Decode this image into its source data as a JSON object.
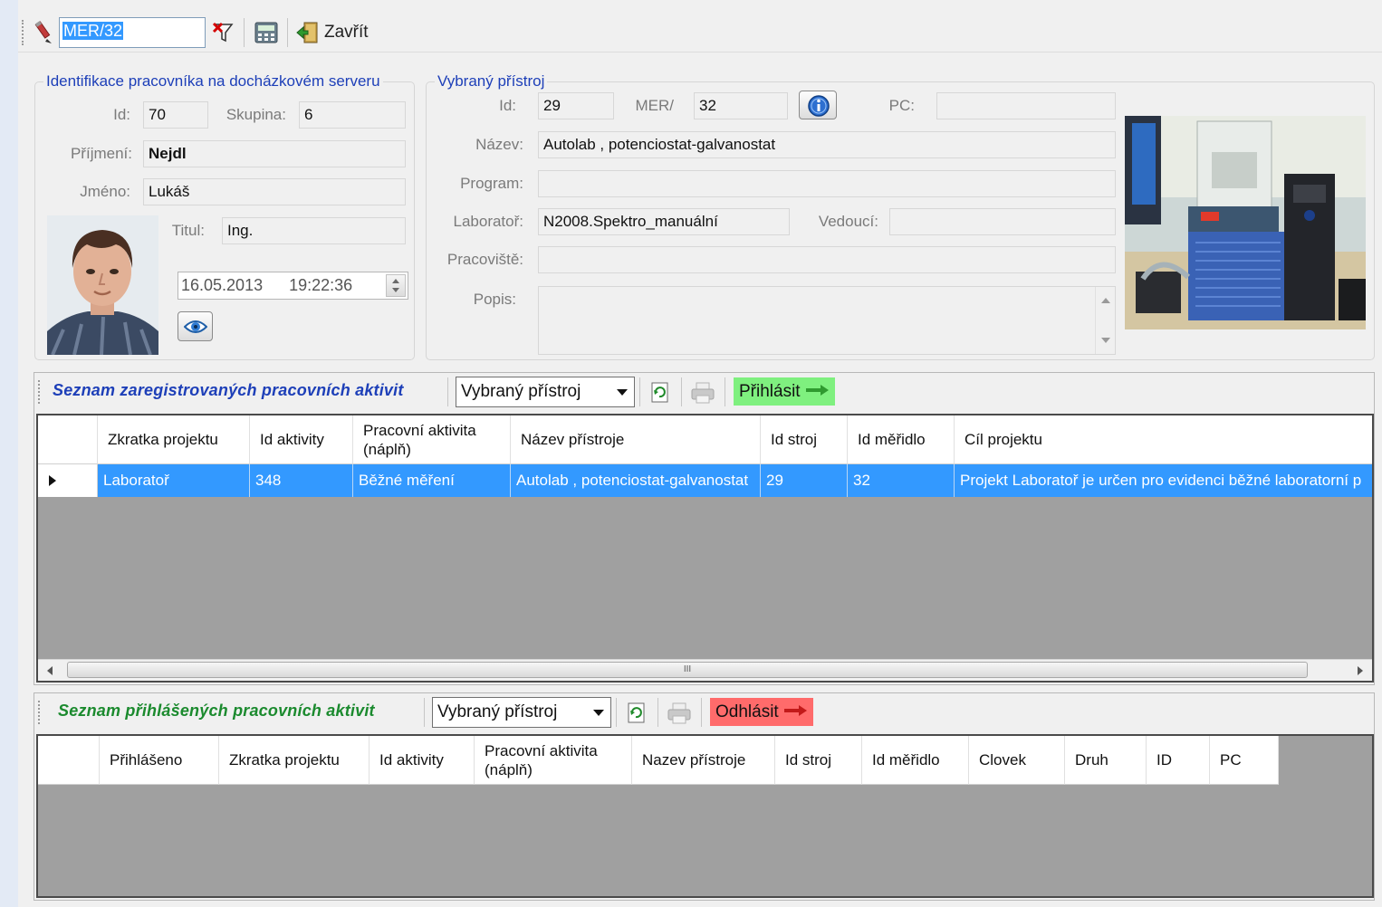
{
  "toolbar": {
    "search_value": "MER/32",
    "close_label": "Zavřít"
  },
  "worker": {
    "group_title": "Identifikace pracovníka na docházkovém serveru",
    "id_label": "Id:",
    "id_value": "70",
    "group_label": "Skupina:",
    "group_value": "6",
    "surname_label": "Příjmení:",
    "surname_value": "Nejdl",
    "name_label": "Jméno:",
    "name_value": "Lukáš",
    "title_label": "Titul:",
    "title_value": "Ing.",
    "date_value": "16.05.2013",
    "time_value": "19:22:36"
  },
  "device": {
    "group_title": "Vybraný přístroj",
    "id_label": "Id:",
    "id_value": "29",
    "mer_label": "MER/",
    "mer_value": "32",
    "pc_label": "PC:",
    "pc_value": "",
    "name_label": "Název:",
    "name_value": "Autolab , potenciostat-galvanostat",
    "program_label": "Program:",
    "program_value": "",
    "lab_label": "Laboratoř:",
    "lab_value": "N2008.Spektro_manuální",
    "head_label": "Vedoucí:",
    "head_value": "",
    "workplace_label": "Pracoviště:",
    "workplace_value": "",
    "desc_label": "Popis:",
    "desc_value": ""
  },
  "registered": {
    "title": "Seznam zaregistrovaných pracovních aktivit",
    "filter_value": "Vybraný přístroj",
    "action_label": "Přihlásit",
    "columns": [
      "Zkratka projektu",
      "Id aktivity",
      "Pracovní aktivita (náplň)",
      "Název přístroje",
      "Id stroj",
      "Id měřidlo",
      "Cíl projektu"
    ],
    "row": {
      "project": "Laboratoř",
      "activity_id": "348",
      "activity": "Běžné měření",
      "device_name": "Autolab , potenciostat-galvanostat",
      "machine_id": "29",
      "meter_id": "32",
      "goal": "Projekt Laboratoř je určen pro evidenci běžné laboratorní p"
    },
    "scroll_mark": "III"
  },
  "logged": {
    "title": "Seznam přihlášených pracovních aktivit",
    "filter_value": "Vybraný přístroj",
    "action_label": "Odhlásit",
    "columns": [
      "Přihlášeno",
      "Zkratka projektu",
      "Id aktivity",
      "Pracovní aktivita (náplň)",
      "Nazev přístroje",
      "Id stroj",
      "Id měřidlo",
      "Clovek",
      "Druh",
      "ID",
      "PC"
    ]
  },
  "colors": {
    "accent_blue": "#1d3fb8",
    "logged_green": "#1b8a2e",
    "selection": "#3399ff",
    "login_btn": "#7ff07f",
    "logout_btn": "#ff6b6b"
  }
}
